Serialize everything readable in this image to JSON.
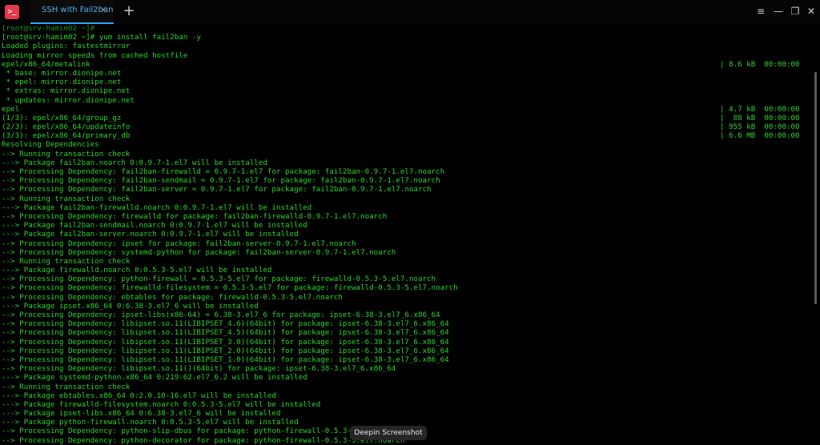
{
  "window": {
    "app_icon_glyph": ">_",
    "tab_label": "SSH with Fail2ban",
    "tab_close": "×",
    "add_tab": "+",
    "menu_icon": "≡",
    "min_icon": "—",
    "max_icon": "❐",
    "close_icon": "✕"
  },
  "colors": {
    "terminal_text": "#2bd42b",
    "accent_tab": "#2ca7f8",
    "app_icon_bg": "#e23b4c"
  },
  "terminal": {
    "lines": [
      {
        "text": "[root@srv-hamim02 ~]#",
        "right": ""
      },
      {
        "text": "[root@srv-hamim02 ~]# yum install fail2ban -y",
        "right": ""
      },
      {
        "text": "Loaded plugins: fastestmirror",
        "right": ""
      },
      {
        "text": "Loading mirror speeds from cached hostfile",
        "right": ""
      },
      {
        "text": "epel/x86_64/metalink",
        "right": "| 8.6 kB  00:00:00"
      },
      {
        "text": " * base: mirror.dionipe.net",
        "right": ""
      },
      {
        "text": " * epel: mirror.dionipe.net",
        "right": ""
      },
      {
        "text": " * extras: mirror.dionipe.net",
        "right": ""
      },
      {
        "text": " * updates: mirror.dionipe.net",
        "right": ""
      },
      {
        "text": "epel",
        "right": "| 4.7 kB  00:00:00"
      },
      {
        "text": "(1/3): epel/x86_64/group_gz",
        "right": "|  88 kB  00:00:00"
      },
      {
        "text": "(2/3): epel/x86_64/updateinfo",
        "right": "| 955 kB  00:00:00"
      },
      {
        "text": "(3/3): epel/x86_64/primary_db",
        "right": "| 6.6 MB  00:00:00"
      },
      {
        "text": "Resolving Dependencies",
        "right": ""
      },
      {
        "text": "--> Running transaction check",
        "right": ""
      },
      {
        "text": "---> Package fail2ban.noarch 0:0.9.7-1.el7 will be installed",
        "right": ""
      },
      {
        "text": "--> Processing Dependency: fail2ban-firewalld = 0.9.7-1.el7 for package: fail2ban-0.9.7-1.el7.noarch",
        "right": ""
      },
      {
        "text": "--> Processing Dependency: fail2ban-sendmail = 0.9.7-1.el7 for package: fail2ban-0.9.7-1.el7.noarch",
        "right": ""
      },
      {
        "text": "--> Processing Dependency: fail2ban-server = 0.9.7-1.el7 for package: fail2ban-0.9.7-1.el7.noarch",
        "right": ""
      },
      {
        "text": "--> Running transaction check",
        "right": ""
      },
      {
        "text": "---> Package fail2ban-firewalld.noarch 0:0.9.7-1.el7 will be installed",
        "right": ""
      },
      {
        "text": "--> Processing Dependency: firewalld for package: fail2ban-firewalld-0.9.7-1.el7.noarch",
        "right": ""
      },
      {
        "text": "---> Package fail2ban-sendmail.noarch 0:0.9.7-1.el7 will be installed",
        "right": ""
      },
      {
        "text": "---> Package fail2ban-server.noarch 0:0.9.7-1.el7 will be installed",
        "right": ""
      },
      {
        "text": "--> Processing Dependency: ipset for package: fail2ban-server-0.9.7-1.el7.noarch",
        "right": ""
      },
      {
        "text": "--> Processing Dependency: systemd-python for package: fail2ban-server-0.9.7-1.el7.noarch",
        "right": ""
      },
      {
        "text": "--> Running transaction check",
        "right": ""
      },
      {
        "text": "---> Package firewalld.noarch 0:0.5.3-5.el7 will be installed",
        "right": ""
      },
      {
        "text": "--> Processing Dependency: python-firewall = 0.5.3-5.el7 for package: firewalld-0.5.3-5.el7.noarch",
        "right": ""
      },
      {
        "text": "--> Processing Dependency: firewalld-filesystem = 0.5.3-5.el7 for package: firewalld-0.5.3-5.el7.noarch",
        "right": ""
      },
      {
        "text": "--> Processing Dependency: ebtables for package: firewalld-0.5.3-5.el7.noarch",
        "right": ""
      },
      {
        "text": "---> Package ipset.x86_64 0:6.38-3.el7_6 will be installed",
        "right": ""
      },
      {
        "text": "--> Processing Dependency: ipset-libs(x86-64) = 6.38-3.el7_6 for package: ipset-6.38-3.el7_6.x86_64",
        "right": ""
      },
      {
        "text": "--> Processing Dependency: libipset.so.11(LIBIPSET_4.6)(64bit) for package: ipset-6.38-3.el7_6.x86_64",
        "right": ""
      },
      {
        "text": "--> Processing Dependency: libipset.so.11(LIBIPSET_4.5)(64bit) for package: ipset-6.38-3.el7_6.x86_64",
        "right": ""
      },
      {
        "text": "--> Processing Dependency: libipset.so.11(LIBIPSET_3.0)(64bit) for package: ipset-6.38-3.el7_6.x86_64",
        "right": ""
      },
      {
        "text": "--> Processing Dependency: libipset.so.11(LIBIPSET_2.0)(64bit) for package: ipset-6.38-3.el7_6.x86_64",
        "right": ""
      },
      {
        "text": "--> Processing Dependency: libipset.so.11(LIBIPSET_1.0)(64bit) for package: ipset-6.38-3.el7_6.x86_64",
        "right": ""
      },
      {
        "text": "--> Processing Dependency: libipset.so.11()(64bit) for package: ipset-6.38-3.el7_6.x86_64",
        "right": ""
      },
      {
        "text": "---> Package systemd-python.x86_64 0:219-62.el7_6.2 will be installed",
        "right": ""
      },
      {
        "text": "--> Running transaction check",
        "right": ""
      },
      {
        "text": "---> Package ebtables.x86_64 0:2.0.10-16.el7 will be installed",
        "right": ""
      },
      {
        "text": "---> Package firewalld-filesystem.noarch 0:0.5.3-5.el7 will be installed",
        "right": ""
      },
      {
        "text": "---> Package ipset-libs.x86_64 0:6.38-3.el7_6 will be installed",
        "right": ""
      },
      {
        "text": "---> Package python-firewall.noarch 0:0.5.3-5.el7 will be installed",
        "right": ""
      },
      {
        "text": "--> Processing Dependency: python-slip-dbus for package: python-firewall-0.5.3-5.el7.noarch",
        "right": ""
      },
      {
        "text": "--> Processing Dependency: python-decorator for package: python-firewall-0.5.3-5.el7.noarch",
        "right": ""
      }
    ]
  },
  "tooltip": {
    "text": "Deepin Screenshot"
  }
}
